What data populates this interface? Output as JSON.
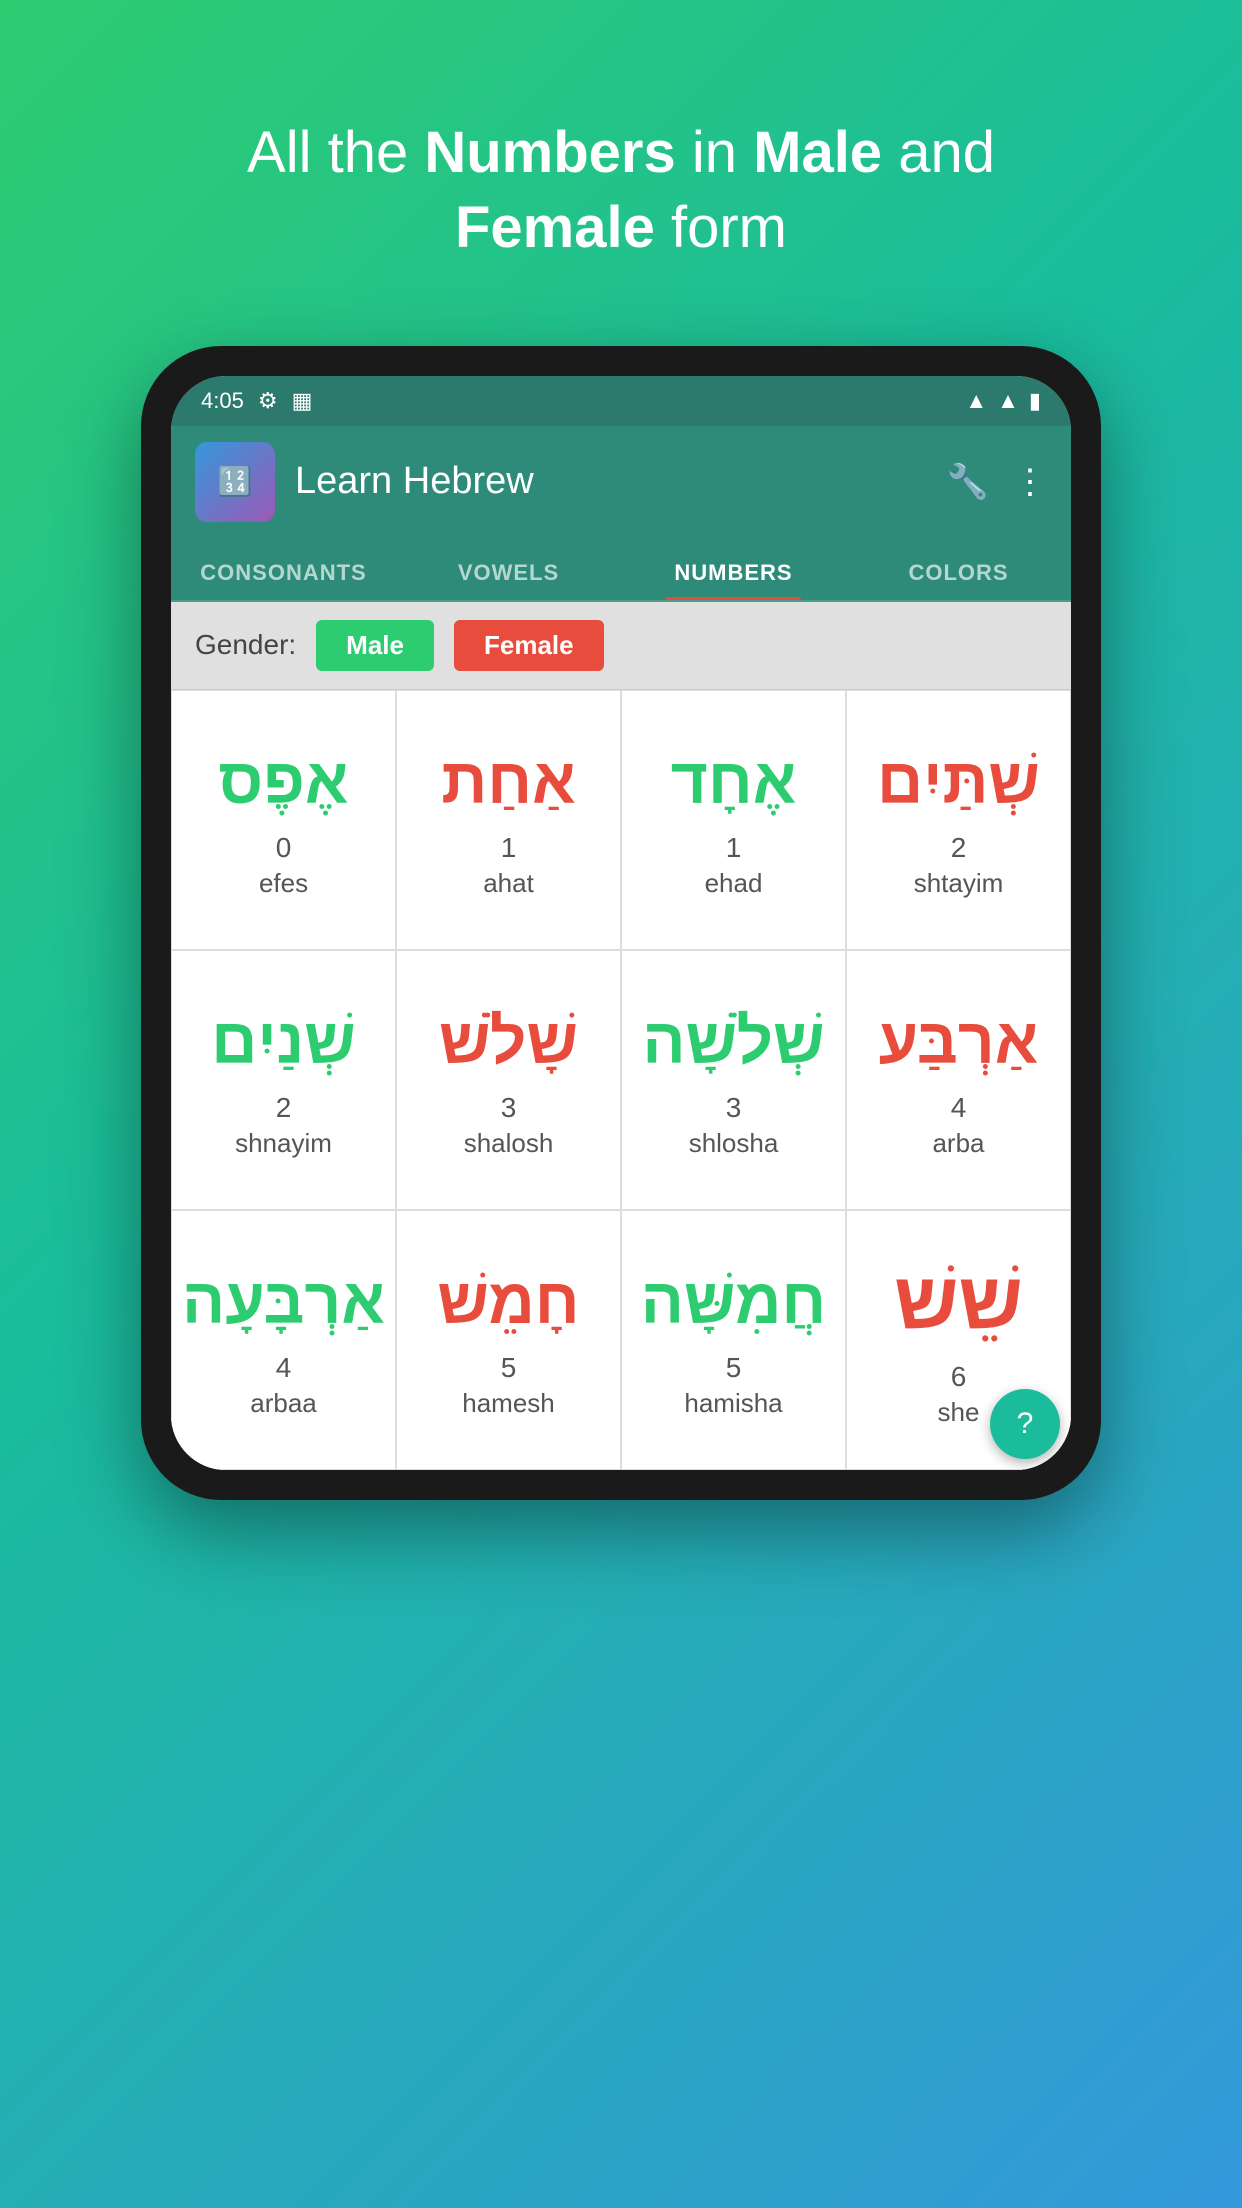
{
  "hero": {
    "line1": "All the ",
    "bold1": "Numbers",
    "line2": " in ",
    "bold2": "Male",
    "line3": "  and",
    "line4": "",
    "bold3": "Female",
    "line5": " form"
  },
  "status_bar": {
    "time": "4:05",
    "wifi_icon": "▲",
    "signal_icon": "▲",
    "battery_icon": "▮"
  },
  "app_bar": {
    "title": "Learn Hebrew",
    "wrench_icon": "🔧",
    "more_icon": "⋮"
  },
  "tabs": [
    {
      "id": "consonants",
      "label": "CONSONANTS",
      "active": false
    },
    {
      "id": "vowels",
      "label": "VOWELS",
      "active": false
    },
    {
      "id": "numbers",
      "label": "NUMBERS",
      "active": true
    },
    {
      "id": "colors",
      "label": "COLORS",
      "active": false
    }
  ],
  "gender_bar": {
    "label": "Gender:",
    "male_btn": "Male",
    "female_btn": "Female"
  },
  "numbers": [
    {
      "hebrew": "אֶפֶס",
      "color": "green",
      "num": "0",
      "trans": "efes"
    },
    {
      "hebrew": "אַחַת",
      "color": "red",
      "num": "1",
      "trans": "ahat"
    },
    {
      "hebrew": "אֶחָד",
      "color": "green",
      "num": "1",
      "trans": "ehad"
    },
    {
      "hebrew": "שְׁתַּיִם",
      "color": "red",
      "num": "2",
      "trans": "shtayim"
    },
    {
      "hebrew": "שְׁנַיִם",
      "color": "green",
      "num": "2",
      "trans": "shnayim"
    },
    {
      "hebrew": "שָׁלֹשׁ",
      "color": "red",
      "num": "3",
      "trans": "shalosh"
    },
    {
      "hebrew": "שְׁלֹשָׁה",
      "color": "green",
      "num": "3",
      "trans": "shlosha"
    },
    {
      "hebrew": "אַרְבַּע",
      "color": "red",
      "num": "4",
      "trans": "arba"
    },
    {
      "hebrew": "אַרְבָּעָה",
      "color": "green",
      "num": "4",
      "trans": "arbaa"
    },
    {
      "hebrew": "חָמֵשׁ",
      "color": "red",
      "num": "5",
      "trans": "hamesh"
    },
    {
      "hebrew": "חֲמִשָּׁה",
      "color": "green",
      "num": "5",
      "trans": "hamisha"
    },
    {
      "hebrew": "שֵׁשׁ",
      "color": "red",
      "num": "6",
      "trans": "she..."
    }
  ],
  "fab_icon": "?"
}
